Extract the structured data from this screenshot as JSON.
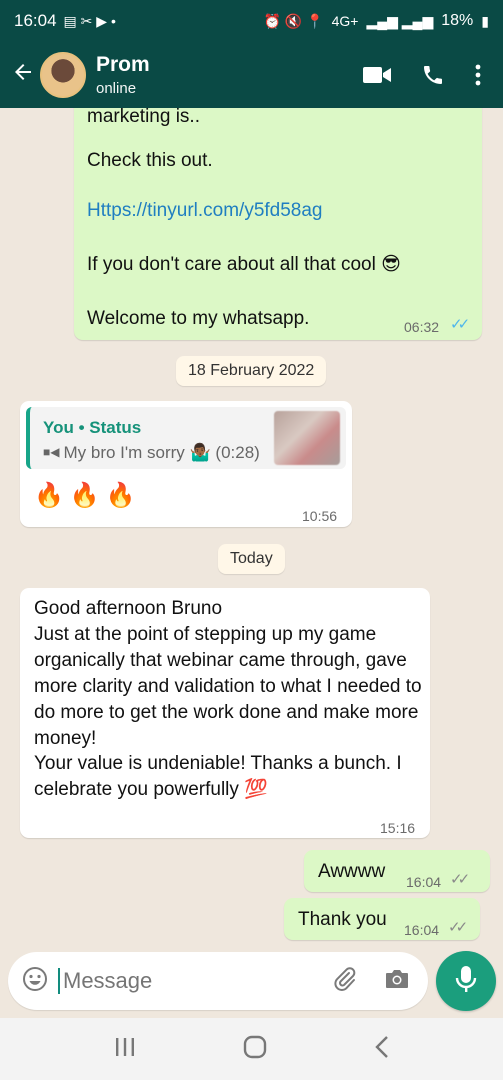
{
  "status_bar": {
    "time": "16:04",
    "battery": "18%",
    "network": "4G+"
  },
  "contact": {
    "name": "Prom",
    "status": "online"
  },
  "messages": {
    "m1": {
      "partial_line": "marketing is..",
      "check": "Check this out.",
      "link": "Https://tinyurl.com/y5fd58ag",
      "cool": "If you don't care about all that cool 😎",
      "welcome": "Welcome to my whatsapp.",
      "time": "06:32"
    },
    "date1": "18 February 2022",
    "m2": {
      "quote_title": "You • Status",
      "quote_text": "My bro I'm sorry 🤷🏾‍♂️ (0:28)",
      "body": "🔥🔥🔥",
      "time": "10:56"
    },
    "date2": "Today",
    "m3": {
      "body": "Good afternoon Bruno\nJust at the point of stepping up my game organically that webinar came through, gave more clarity and validation to what I needed to do more to get the work done and make more money!\nYour value is undeniable! Thanks a bunch. I celebrate you powerfully 💯",
      "time": "15:16"
    },
    "m4": {
      "body": "Awwww",
      "time": "16:04"
    },
    "m5": {
      "body": "Thank you",
      "time": "16:04"
    }
  },
  "composer": {
    "placeholder": "Message"
  },
  "icons": [
    "back-arrow-icon",
    "video-call-icon",
    "phone-icon",
    "more-icon",
    "emoji-icon",
    "attach-icon",
    "camera-icon",
    "mic-icon"
  ],
  "colors": {
    "header": "#0a4a45",
    "outgoing": "#dcf8c6",
    "incoming": "#ffffff",
    "accent": "#1b9e7d",
    "read_tick": "#4fb6ec"
  }
}
